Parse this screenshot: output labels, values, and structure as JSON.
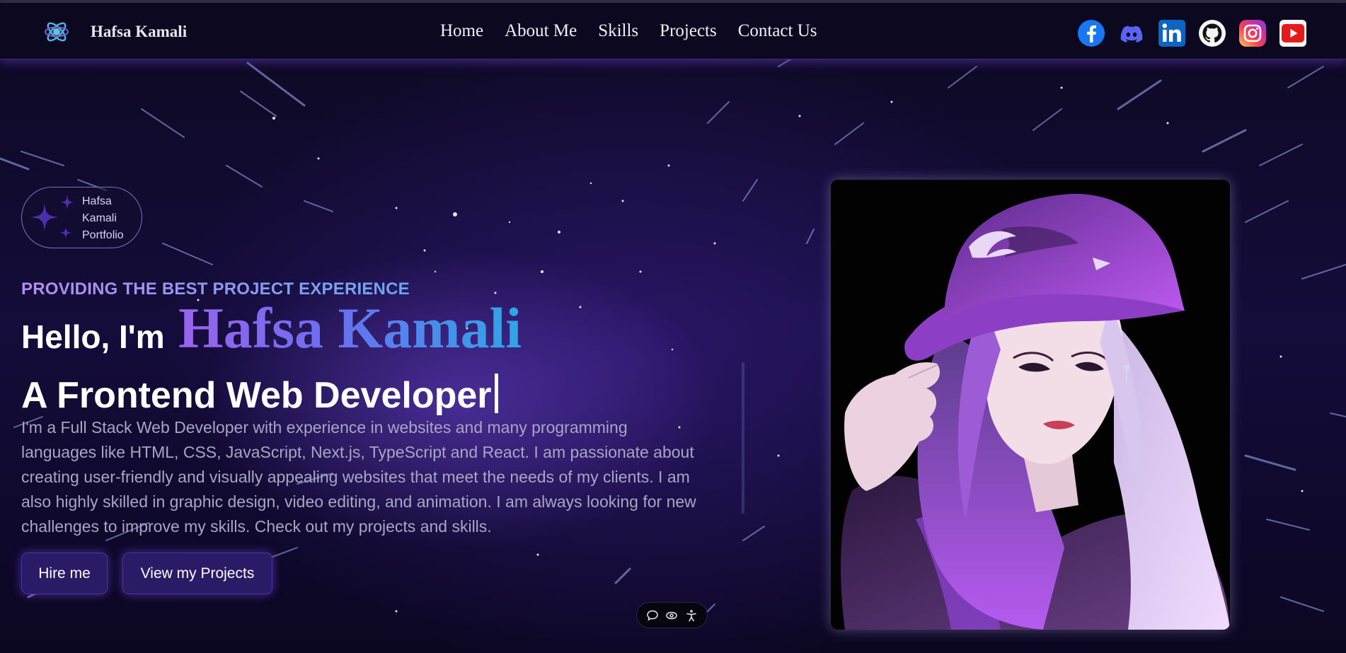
{
  "brand": {
    "name": "Hafsa Kamali"
  },
  "nav": {
    "links": [
      "Home",
      "About Me",
      "Skills",
      "Projects",
      "Contact Us"
    ]
  },
  "socials": [
    "facebook-icon",
    "discord-icon",
    "linkedin-icon",
    "github-icon",
    "instagram-icon",
    "youtube-icon"
  ],
  "hero": {
    "badge_lines": [
      "Hafsa",
      "Kamali",
      "Portfolio"
    ],
    "tagline": "PROVIDING THE BEST PROJECT EXPERIENCE",
    "greeting": "Hello, I'm",
    "name": "Hafsa Kamali",
    "role": "A Frontend Web Developer",
    "bio": "I'm a Full Stack Web Developer with experience in websites and many programming languages like HTML, CSS, JavaScript, Next.js, TypeScript and React. I am passionate about creating user-friendly and visually appealing websites that meet the needs of my clients. I am also highly skilled in graphic design, video editing, and animation. I am always looking for new challenges to improve my skills. Check out my projects and skills.",
    "primary_button": "Hire me",
    "secondary_button": "View my Projects"
  },
  "floating_toolbar": [
    "chat-icon",
    "eye-icon",
    "accessibility-icon"
  ],
  "colors": {
    "accent_purple": "#9b63ee",
    "accent_blue": "#2fa6e6",
    "button_bg": "#2b1a66",
    "nav_bg": "#0b0820"
  }
}
